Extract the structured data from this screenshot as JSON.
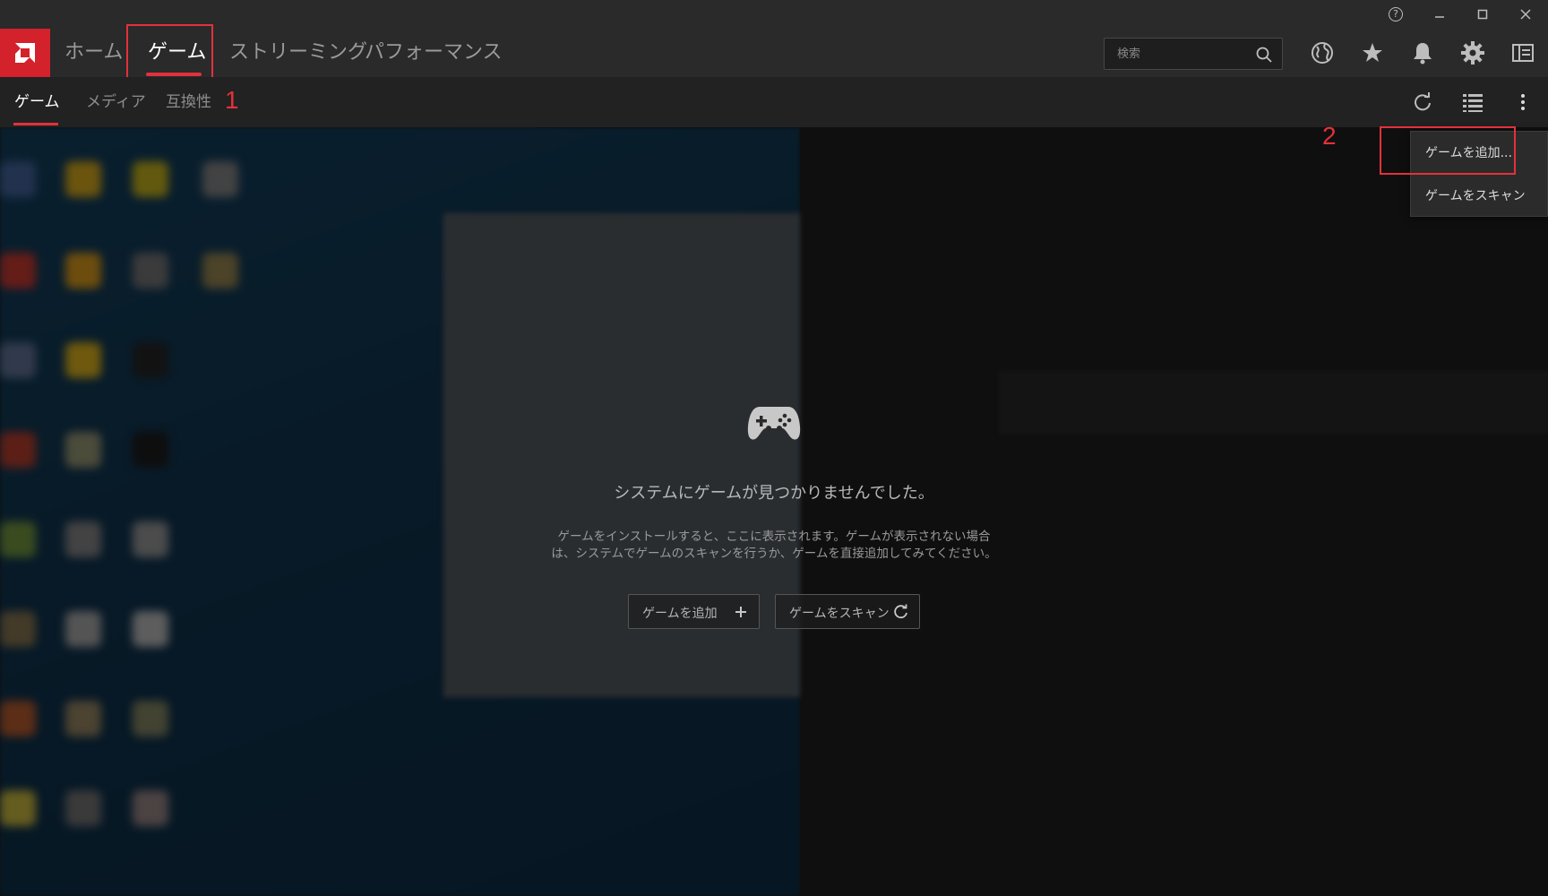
{
  "window": {
    "controls": [
      "help",
      "minimize",
      "maximize",
      "close"
    ]
  },
  "top_nav": {
    "tabs": [
      {
        "label": "ホーム"
      },
      {
        "label": "ゲーム"
      },
      {
        "label": "ストリーミング"
      },
      {
        "label": "パフォーマンス"
      }
    ],
    "active_tab": "ゲーム",
    "search": {
      "placeholder": "検索",
      "value": ""
    },
    "icons": [
      "globe-icon",
      "star-icon",
      "bell-icon",
      "gear-icon",
      "sidebar-toggle-icon"
    ]
  },
  "sub_nav": {
    "tabs": [
      {
        "label": "ゲーム"
      },
      {
        "label": "メディア"
      },
      {
        "label": "互換性"
      }
    ],
    "active_tab": "ゲーム",
    "icons": [
      "refresh-icon",
      "list-view-icon",
      "more-options-icon"
    ]
  },
  "annotations": {
    "marker_1": "1",
    "marker_2": "2"
  },
  "dropdown": {
    "items": [
      {
        "label": "ゲームを追加..."
      },
      {
        "label": "ゲームをスキャン"
      }
    ]
  },
  "empty_state": {
    "icon": "gamepad-icon",
    "title": "システムにゲームが見つかりませんでした。",
    "description_line1": "ゲームをインストールすると、ここに表示されます。ゲームが表示されない場合",
    "description_line2": "は、システムでゲームのスキャンを行うか、ゲームを直接追加してみてください。",
    "add_button": "ゲームを追加",
    "scan_button": "ゲームをスキャン"
  },
  "colors": {
    "accent": "#e0323c",
    "annotation_red": "#e3313b",
    "logo_bg": "#d3222b",
    "nav_bg": "#2a2a2a",
    "subnav_bg": "#222222"
  }
}
